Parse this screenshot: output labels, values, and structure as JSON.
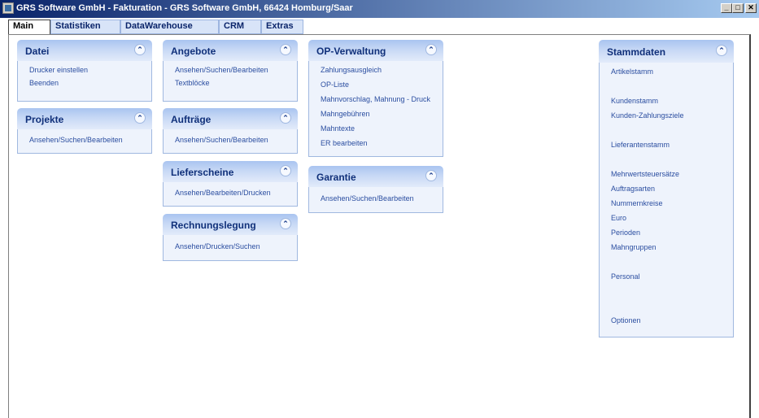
{
  "window": {
    "title": "GRS Software GmbH - Fakturation - GRS Software GmbH, 66424 Homburg/Saar",
    "min_glyph": "_",
    "max_glyph": "□",
    "close_glyph": "✕"
  },
  "tabs": [
    "Main",
    "Statistiken",
    "DataWarehouse",
    "CRM",
    "Extras"
  ],
  "panels": {
    "datei": {
      "title": "Datei",
      "items": [
        "Drucker einstellen",
        "Beenden"
      ]
    },
    "projekte": {
      "title": "Projekte",
      "items": [
        "Ansehen/Suchen/Bearbeiten"
      ]
    },
    "angebote": {
      "title": "Angebote",
      "items": [
        "Ansehen/Suchen/Bearbeiten",
        "Textblöcke"
      ]
    },
    "auftraege": {
      "title": "Aufträge",
      "items": [
        "Ansehen/Suchen/Bearbeiten"
      ]
    },
    "lieferscheine": {
      "title": "Lieferscheine",
      "items": [
        "Ansehen/Bearbeiten/Drucken"
      ]
    },
    "rechnungslegung": {
      "title": "Rechnungslegung",
      "items": [
        "Ansehen/Drucken/Suchen"
      ]
    },
    "op_verwaltung": {
      "title": "OP-Verwaltung",
      "items": [
        "Zahlungsausgleich",
        "OP-Liste",
        "Mahnvorschlag, Mahnung - Druck",
        "Mahngebühren",
        "Mahntexte",
        "ER bearbeiten"
      ]
    },
    "garantie": {
      "title": "Garantie",
      "items": [
        "Ansehen/Suchen/Bearbeiten"
      ]
    },
    "stammdaten": {
      "title": "Stammdaten",
      "items": [
        "Artikelstamm",
        "Kundenstamm",
        "Kunden-Zahlungsziele",
        "Lieferantenstamm",
        "Mehrwertsteuersätze",
        "Auftragsarten",
        "Nummernkreise",
        "Euro",
        "Perioden",
        "Mahngruppen",
        "Personal",
        "Optionen"
      ]
    }
  },
  "icons": {
    "collapse": "chevron-up-double-icon",
    "app": "app-icon"
  },
  "colors": {
    "titlebar_start": "#0a246a",
    "titlebar_end": "#a6caf0",
    "panel_header": "#a9c4f0",
    "panel_body": "#eef3fc",
    "link_text": "#2b4ea0",
    "header_text": "#10307a"
  }
}
